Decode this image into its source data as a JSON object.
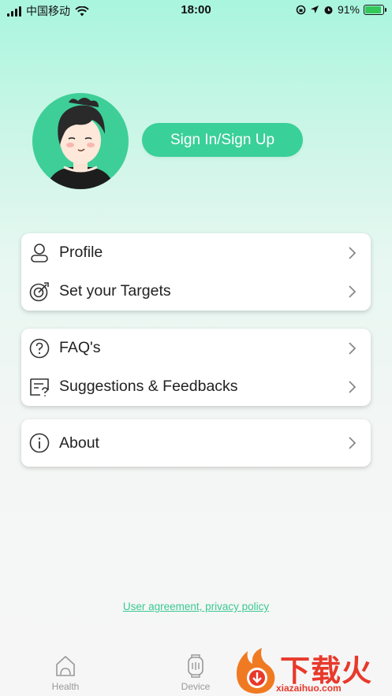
{
  "status_bar": {
    "carrier": "中国移动",
    "time": "18:00",
    "battery": "91%"
  },
  "header": {
    "sign_in_label": "Sign In/Sign Up"
  },
  "menu_groups": [
    {
      "items": [
        {
          "label": "Profile",
          "icon": "person-icon"
        },
        {
          "label": "Set your Targets",
          "icon": "target-icon"
        }
      ]
    },
    {
      "items": [
        {
          "label": "FAQ's",
          "icon": "question-icon"
        },
        {
          "label": "Suggestions & Feedbacks",
          "icon": "feedback-icon"
        }
      ]
    },
    {
      "items": [
        {
          "label": "About",
          "icon": "info-icon"
        }
      ]
    }
  ],
  "footer": {
    "agreement_link": "User agreement, privacy policy"
  },
  "tabbar": {
    "tabs": [
      {
        "label": "Health",
        "icon": "heart-house-icon"
      },
      {
        "label": "Device",
        "icon": "watch-icon"
      }
    ]
  },
  "watermark": {
    "title": "下载火",
    "domain": "xiazaihuo.com"
  },
  "colors": {
    "accent": "#3AD099",
    "link": "#3BC994",
    "background_top": "#A9F5DE",
    "background_bottom": "#F6F6F6"
  }
}
